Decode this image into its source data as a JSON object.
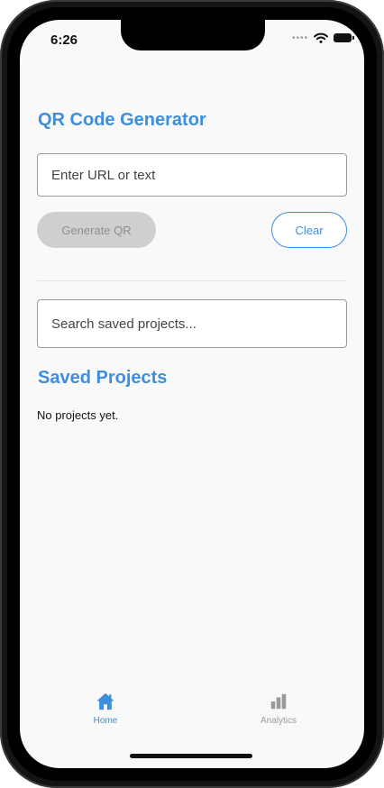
{
  "status_bar": {
    "time": "6:26"
  },
  "header": {
    "title": "QR Code Generator"
  },
  "url_input": {
    "placeholder": "Enter URL or text",
    "value": ""
  },
  "actions": {
    "generate_label": "Generate QR",
    "clear_label": "Clear"
  },
  "search": {
    "placeholder": "Search saved projects...",
    "value": ""
  },
  "saved": {
    "title": "Saved Projects",
    "empty_text": "No projects yet."
  },
  "tabs": [
    {
      "label": "Home",
      "icon": "home-icon",
      "active": true
    },
    {
      "label": "Analytics",
      "icon": "bar-chart-icon",
      "active": false
    }
  ],
  "colors": {
    "accent": "#3d8fdd",
    "disabled_bg": "#cfcfcf",
    "background": "#f9f9f9"
  }
}
